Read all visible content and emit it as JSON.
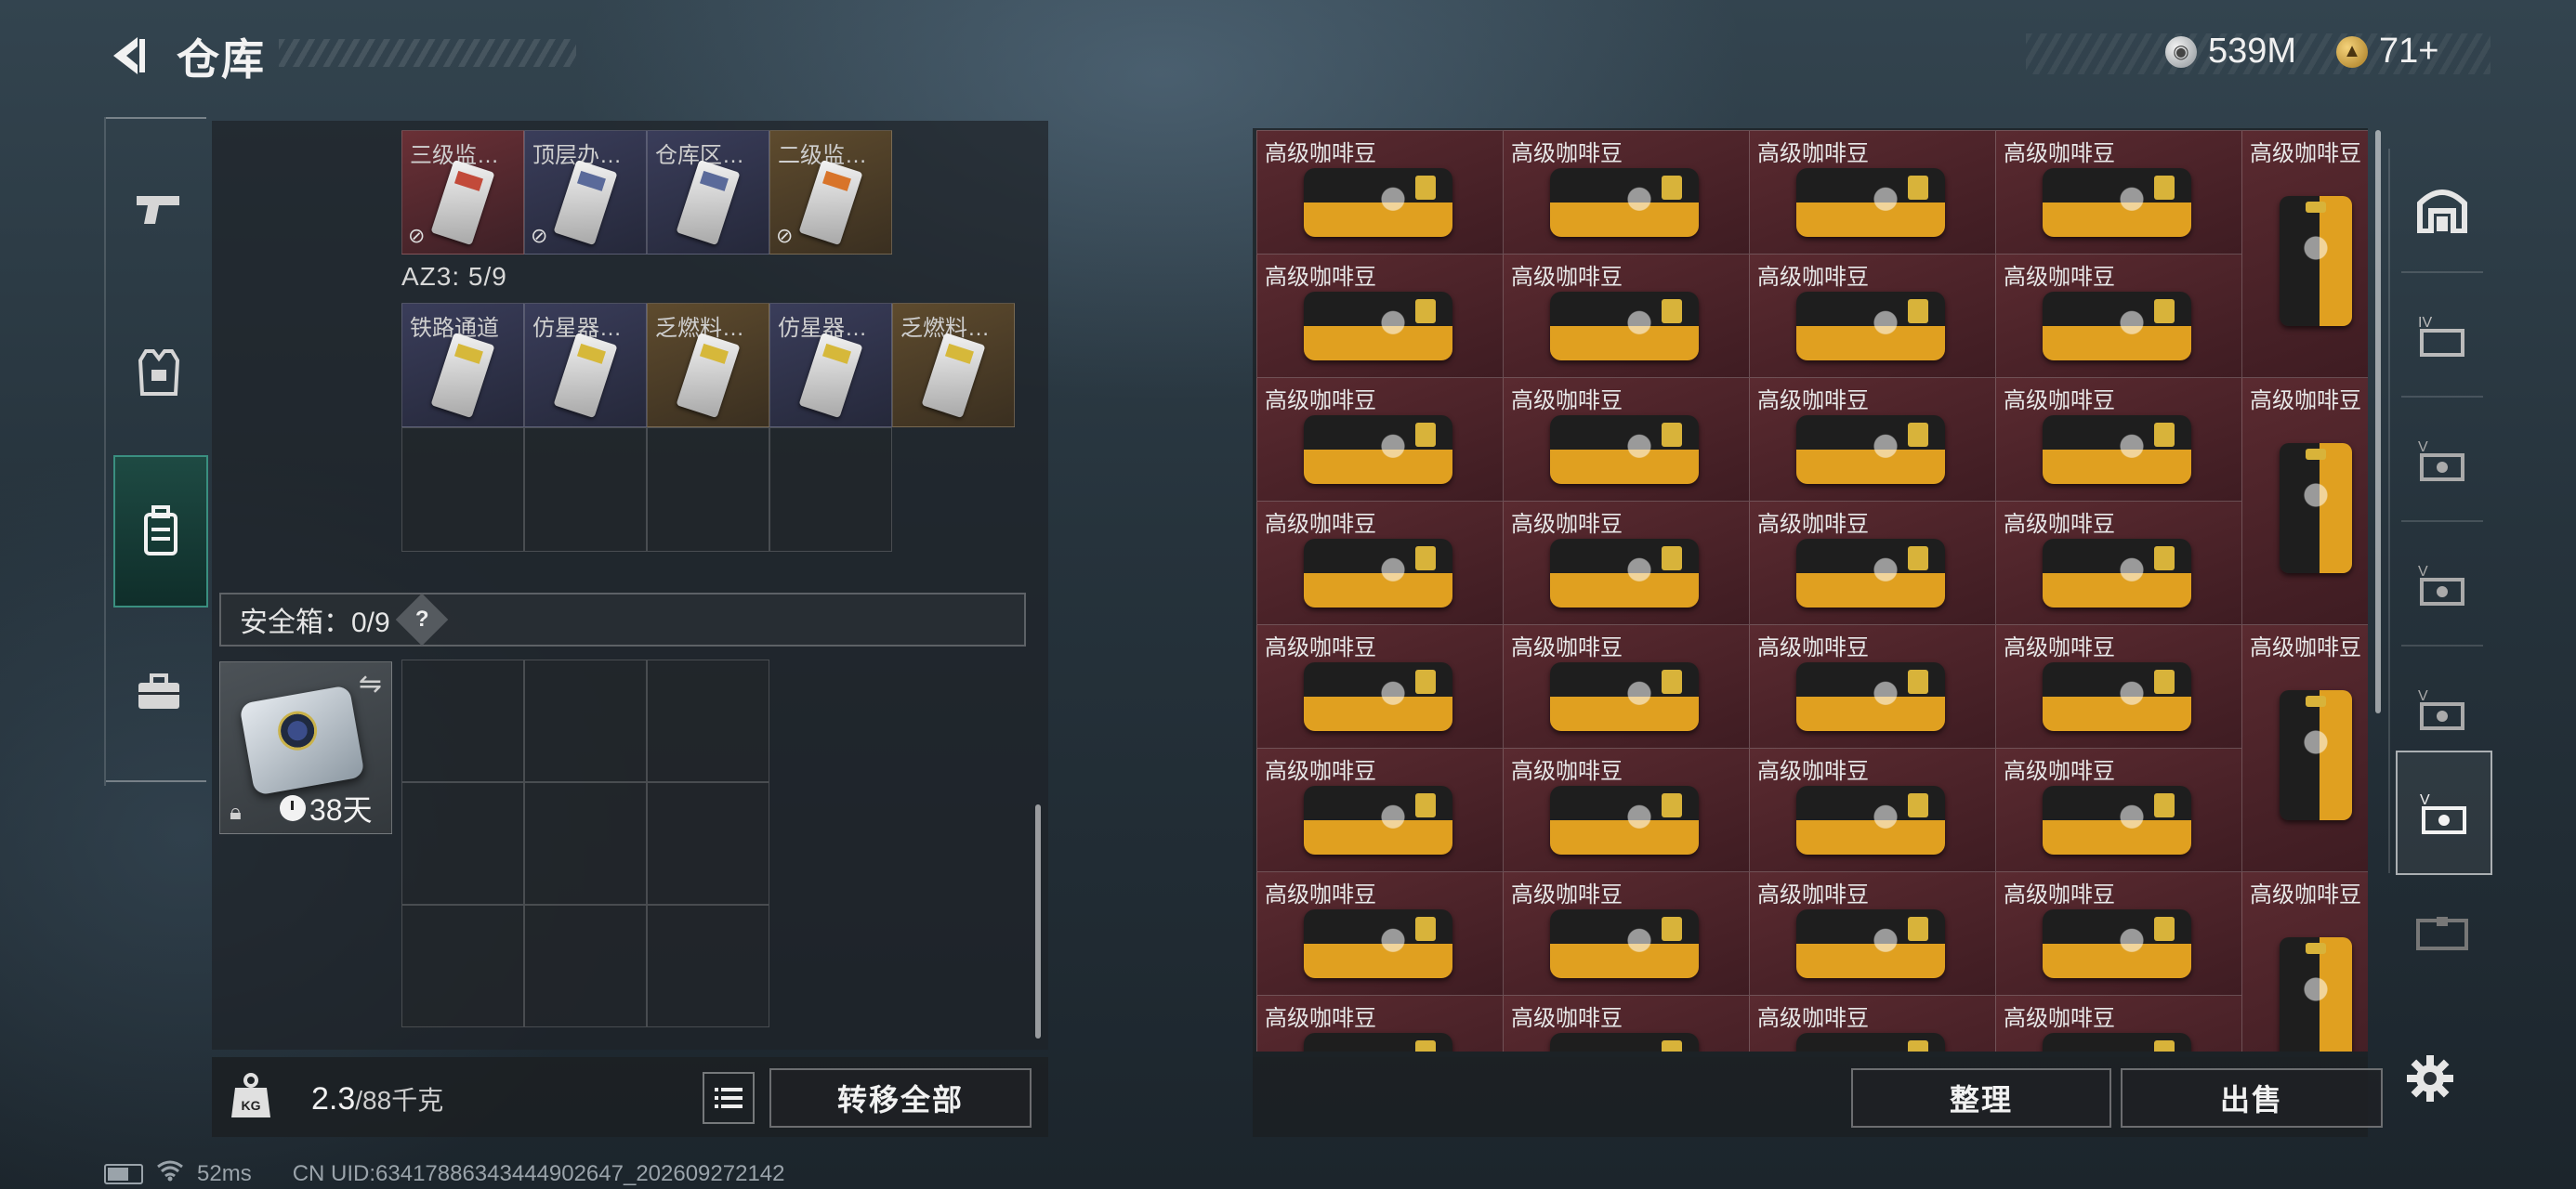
{
  "header": {
    "title": "仓库",
    "currency": [
      {
        "icon": "silver-coin-icon",
        "value": "539M"
      },
      {
        "icon": "gold-coin-icon",
        "value": "71+"
      }
    ]
  },
  "left_rail": {
    "items": [
      {
        "name": "weapons",
        "icon": "pistol-icon",
        "active": false
      },
      {
        "name": "armor",
        "icon": "vest-icon",
        "active": false
      },
      {
        "name": "containers",
        "icon": "backpack-icon",
        "active": true
      },
      {
        "name": "supplies",
        "icon": "toolbox-icon",
        "active": false
      }
    ]
  },
  "keycards": {
    "row1": [
      {
        "label": "三级监狱…",
        "tone": "red",
        "card": "c-red",
        "no_drop": true
      },
      {
        "label": "顶层办公间",
        "tone": "blue",
        "card": "",
        "no_drop": true
      },
      {
        "label": "仓库区监…",
        "tone": "blue",
        "card": "",
        "no_drop": false
      },
      {
        "label": "二级监狱…",
        "tone": "gold",
        "card": "c-orange",
        "no_drop": true
      }
    ],
    "az3": {
      "label": "AZ3: 5/9",
      "items": [
        {
          "label": "铁路通道",
          "tone": "blue",
          "card": "c-yellow"
        },
        {
          "label": "仿星器控…",
          "tone": "blue",
          "card": "c-yellow"
        },
        {
          "label": "乏燃料厂…",
          "tone": "gold",
          "card": "c-yellow"
        },
        {
          "label": "仿星器控…",
          "tone": "blue",
          "card": "c-yellow"
        },
        {
          "label": "乏燃料厂…",
          "tone": "gold",
          "card": "c-yellow"
        }
      ]
    }
  },
  "safebox": {
    "label": "安全箱：0/9",
    "help": "?",
    "timer": "38天"
  },
  "footer_left": {
    "weight_value": "2.3",
    "weight_max": "/88千克",
    "kg_label": "KG",
    "transfer_all": "转移全部"
  },
  "stash": {
    "item_label": "高级咖啡豆",
    "columns": 5,
    "visible_rows": 8
  },
  "footer_right": {
    "sort": "整理",
    "sell": "出售"
  },
  "status": {
    "ping": "52ms",
    "uid": "CN UID:634178863434449026​47_202609272142"
  },
  "colors": {
    "accent_teal": "#3a8f80",
    "coffee_cell": "#5a2a30"
  }
}
